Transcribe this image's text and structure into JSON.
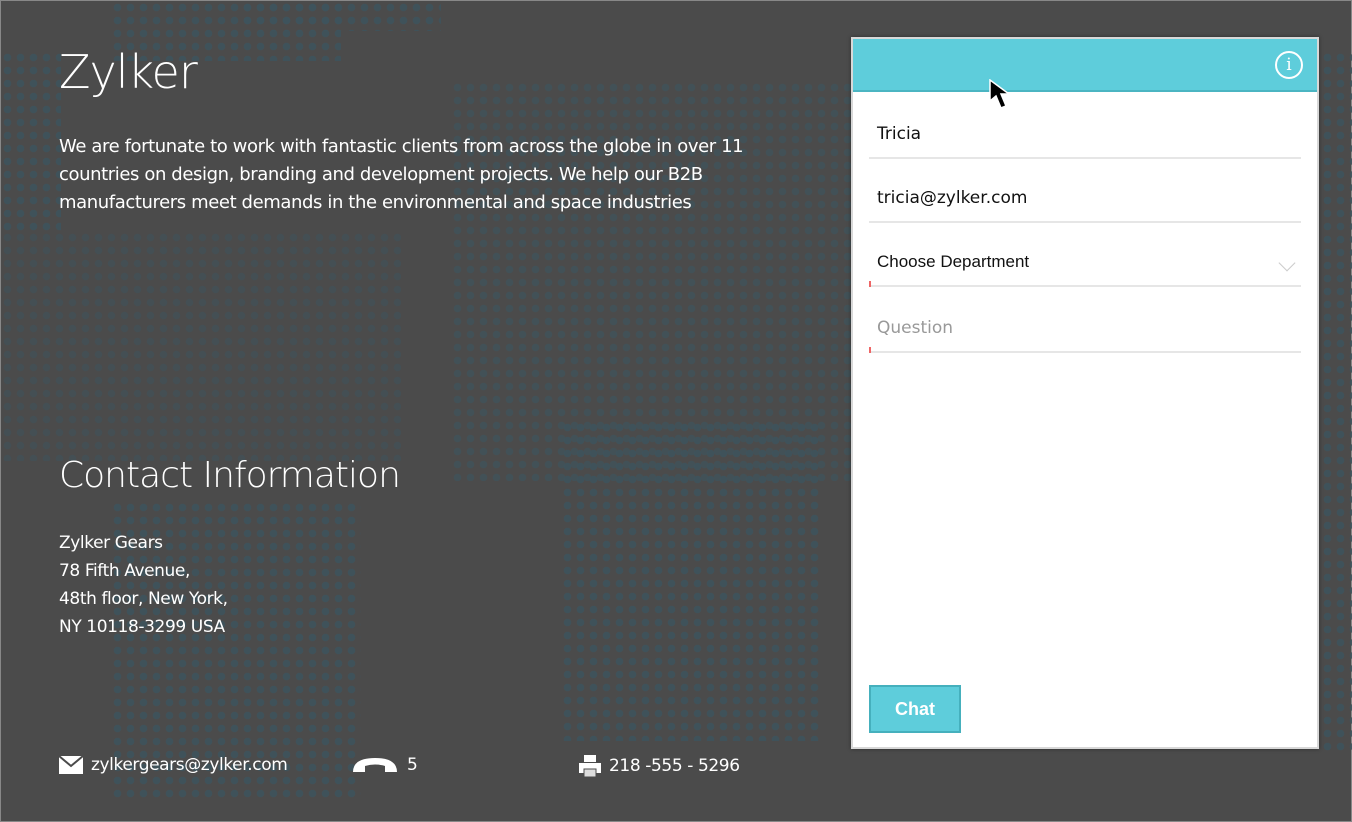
{
  "company": {
    "title": "Zylker",
    "intro": "We are fortunate to work with fantastic clients from across the globe in over 11 countries on design, branding and development projects. We help our B2B manufacturers meet demands in the environmental and space industries"
  },
  "contact": {
    "heading": "Contact Information",
    "lines": [
      "Zylker Gears",
      "78 Fifth Avenue,",
      "48th floor, New York,",
      "NY 10118-3299 USA"
    ],
    "email": "zylkergears@zylker.com",
    "phone": "5",
    "fax": "218 -555 - 5296"
  },
  "chat_form": {
    "name_value": "Tricia",
    "email_value": "tricia@zylker.com",
    "department_placeholder": "Choose Department",
    "question_placeholder": "Question",
    "submit_label": "Chat",
    "info_glyph": "i"
  },
  "colors": {
    "accent": "#5ecddb",
    "background": "#4b4b4b"
  }
}
